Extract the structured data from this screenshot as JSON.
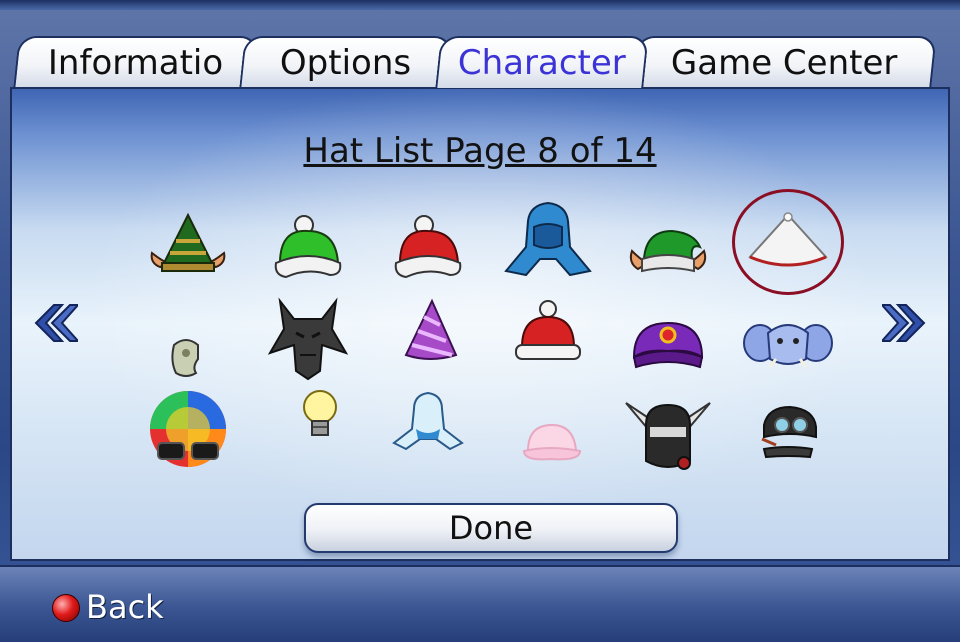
{
  "tabs": [
    {
      "label": "Informatio",
      "active": false
    },
    {
      "label": "Options",
      "active": false
    },
    {
      "label": "Character",
      "active": true
    },
    {
      "label": "Game Center",
      "active": false
    }
  ],
  "page_title": "Hat List Page 8 of 14",
  "pagination": {
    "current": 8,
    "total": 14,
    "prev_icon": "double-chevron-left-icon",
    "next_icon": "double-chevron-right-icon"
  },
  "hats": [
    {
      "icon": "green-elf-hat-icon"
    },
    {
      "icon": "green-pompom-beanie-icon"
    },
    {
      "icon": "red-pompom-beanie-icon"
    },
    {
      "icon": "blue-wizard-hood-icon"
    },
    {
      "icon": "green-elf-cap-with-ears-icon"
    },
    {
      "icon": "white-cone-hat-icon",
      "selected": true
    },
    {
      "icon": "small-rock-hat-icon"
    },
    {
      "icon": "black-dragon-mask-icon"
    },
    {
      "icon": "purple-party-hat-icon"
    },
    {
      "icon": "red-pompom-winter-hat-icon"
    },
    {
      "icon": "purple-turban-icon"
    },
    {
      "icon": "blue-elephant-hat-icon"
    },
    {
      "icon": "rainbow-afro-sunglasses-icon"
    },
    {
      "icon": "lightbulb-hat-icon"
    },
    {
      "icon": "light-blue-hood-icon"
    },
    {
      "icon": "pink-cap-icon"
    },
    {
      "icon": "winged-ninja-mask-icon"
    },
    {
      "icon": "aviator-goggles-cap-icon"
    }
  ],
  "done_label": "Done",
  "back": {
    "label": "Back",
    "icon": "red-circle-button-icon"
  },
  "colors": {
    "active_tab": "#3b33d6",
    "selection_ring": "#8a0f24",
    "arrow": "#2f4fa8"
  }
}
